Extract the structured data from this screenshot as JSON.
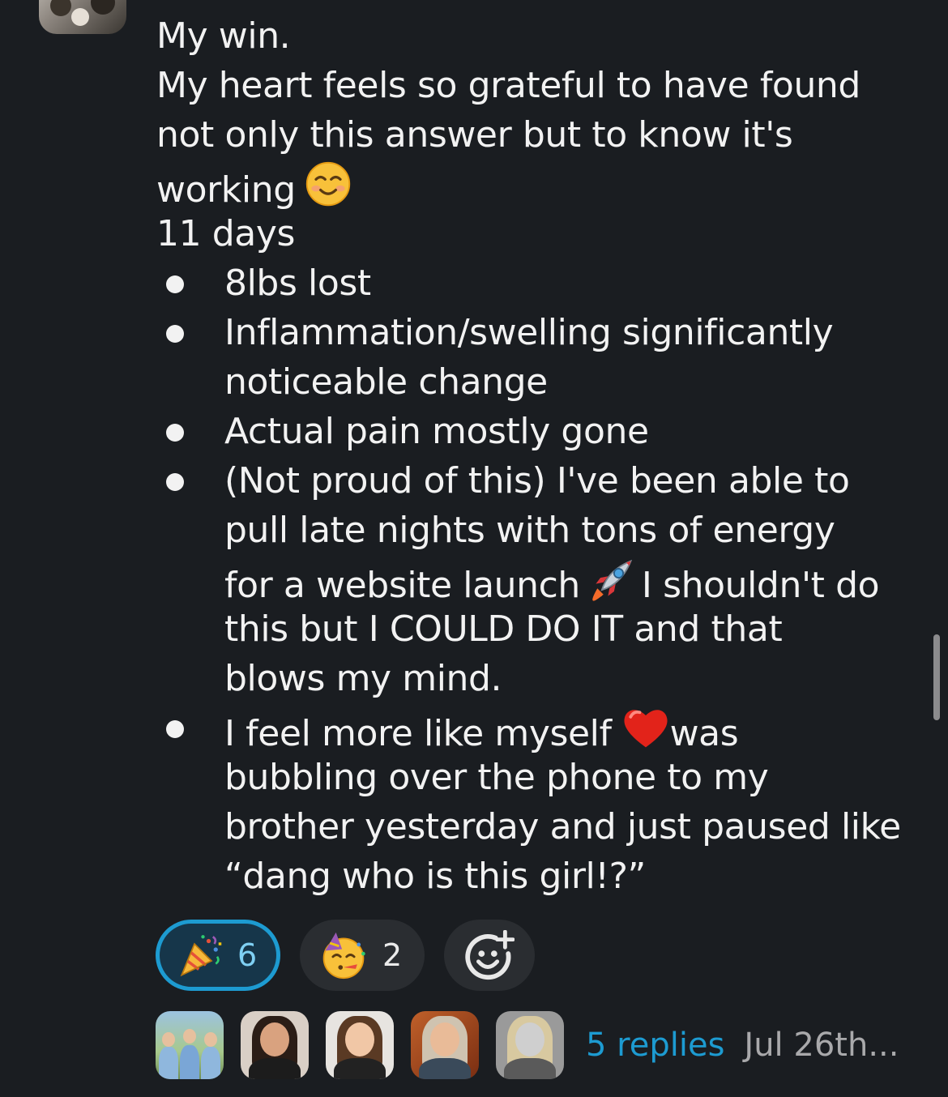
{
  "message": {
    "lines": [
      "My win.",
      "My heart feels so grateful to have found",
      "not only this answer but to know it's",
      "working"
    ],
    "days": "11 days",
    "bullets": [
      {
        "lines": [
          "8lbs lost"
        ]
      },
      {
        "lines": [
          "Inflammation/swelling significantly",
          "noticeable change"
        ]
      },
      {
        "lines": [
          "Actual pain mostly gone"
        ]
      },
      {
        "lines": [
          "(Not proud of this) I've been able to",
          "pull late nights with tons of energy",
          "for a website launch",
          "I shouldn't do",
          "this but I COULD DO IT and that",
          "blows my mind."
        ]
      },
      {
        "lines": [
          "I feel more like myself",
          "was",
          "bubbling over the phone to my",
          "brother yesterday and just paused like",
          "“dang who is this girl!?”"
        ]
      }
    ],
    "emojis": {
      "working": "smiling-face-icon",
      "launch": "rocket-icon",
      "myself": "red-heart-icon"
    }
  },
  "reactions": [
    {
      "icon": "party-popper-icon",
      "count": "6",
      "selected": true
    },
    {
      "icon": "partying-face-icon",
      "count": "2",
      "selected": false
    },
    {
      "icon": "add-reaction-icon"
    }
  ],
  "thread": {
    "reply_count_label": "5 replies",
    "timestamp": "Jul 26th..."
  },
  "colors": {
    "background": "#1a1d21",
    "text": "#f2f2f2",
    "link": "#1d9bd1",
    "muted": "#a9a9ab",
    "selected_reaction_border": "#1d9bd1"
  }
}
